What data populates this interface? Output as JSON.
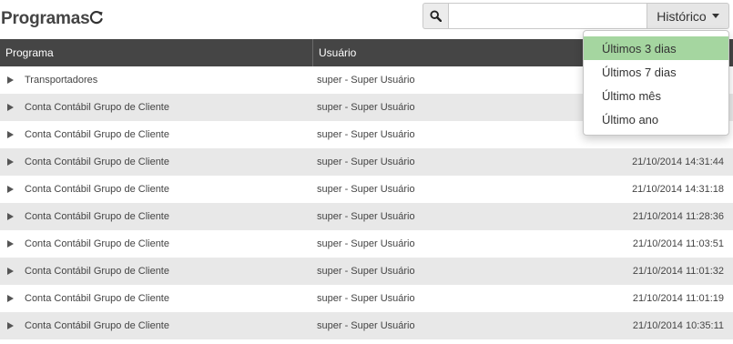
{
  "header": {
    "title": "Programas",
    "refresh_icon": "refresh-icon"
  },
  "search": {
    "icon": "search-icon",
    "value": "",
    "placeholder": ""
  },
  "history": {
    "label": "Histórico",
    "options": [
      "Últimos 3 dias",
      "Últimos 7 dias",
      "Último mês",
      "Último ano"
    ],
    "highlighted": "Últimos 3 dias"
  },
  "table": {
    "columns": [
      "Programa",
      "Usuário"
    ],
    "rows": [
      {
        "programa": "Transportadores",
        "usuario": "super - Super Usuário",
        "data": ""
      },
      {
        "programa": "Conta Contábil Grupo de Cliente",
        "usuario": "super - Super Usuário",
        "data": ""
      },
      {
        "programa": "Conta Contábil Grupo de Cliente",
        "usuario": "super - Super Usuário",
        "data": ""
      },
      {
        "programa": "Conta Contábil Grupo de Cliente",
        "usuario": "super - Super Usuário",
        "data": "21/10/2014 14:31:44"
      },
      {
        "programa": "Conta Contábil Grupo de Cliente",
        "usuario": "super - Super Usuário",
        "data": "21/10/2014 14:31:18"
      },
      {
        "programa": "Conta Contábil Grupo de Cliente",
        "usuario": "super - Super Usuário",
        "data": "21/10/2014 11:28:36"
      },
      {
        "programa": "Conta Contábil Grupo de Cliente",
        "usuario": "super - Super Usuário",
        "data": "21/10/2014 11:03:51"
      },
      {
        "programa": "Conta Contábil Grupo de Cliente",
        "usuario": "super - Super Usuário",
        "data": "21/10/2014 11:01:32"
      },
      {
        "programa": "Conta Contábil Grupo de Cliente",
        "usuario": "super - Super Usuário",
        "data": "21/10/2014 11:01:19"
      },
      {
        "programa": "Conta Contábil Grupo de Cliente",
        "usuario": "super - Super Usuário",
        "data": "21/10/2014 10:35:11"
      }
    ]
  },
  "colors": {
    "header_bg": "#454545",
    "row_alt": "#e8e8e8",
    "highlight": "#a5d6a0"
  }
}
